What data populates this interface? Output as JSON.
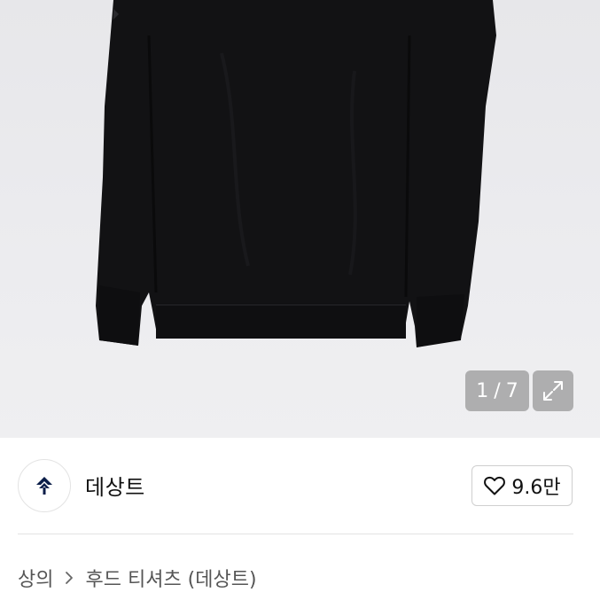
{
  "gallery": {
    "current_page": "1",
    "separator": "/",
    "total_pages": "7",
    "image_icon": "black-sweatshirt",
    "expand_icon": "expand-arrows-icon"
  },
  "seller": {
    "brand_name": "데상트",
    "logo_icon": "descente-arrow-logo",
    "like_icon": "heart-outline-icon",
    "like_count": "9.6만"
  },
  "breadcrumb": {
    "items": [
      "상의",
      "후드 티셔츠 (데상트)"
    ],
    "separator_icon": "chevron-right-icon"
  },
  "colors": {
    "gallery_bg": "#ececef",
    "overlay_bg": "#969696",
    "text_primary": "#111111",
    "text_secondary": "#555555",
    "border": "#cfcfcf"
  }
}
